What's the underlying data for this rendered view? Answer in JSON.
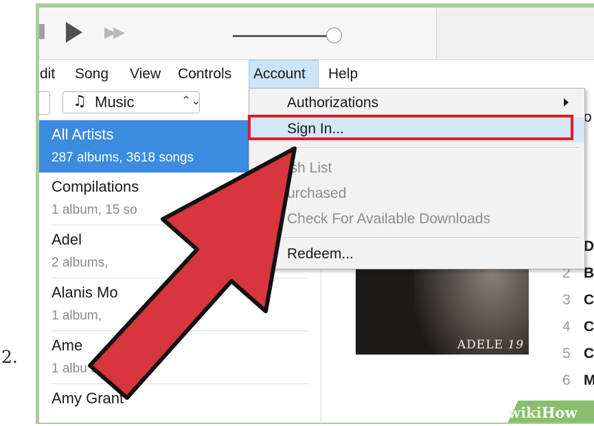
{
  "step_number": "2.",
  "menubar": {
    "items": [
      {
        "label": "dit"
      },
      {
        "label": "Song"
      },
      {
        "label": "View"
      },
      {
        "label": "Controls"
      },
      {
        "label": "Account"
      },
      {
        "label": "Help"
      }
    ],
    "active": "Account"
  },
  "source_select": {
    "icon": "music-note-icon",
    "label": "Music",
    "icon_glyph": "♫",
    "arrows_glyph": "⌃⌄"
  },
  "artists": [
    {
      "name": "All Artists",
      "detail": "287 albums, 3618 songs",
      "selected": true
    },
    {
      "name": "Compilations",
      "detail": "1 album, 15 so",
      "selected": false
    },
    {
      "name": "Adel",
      "detail": "2 albums,",
      "selected": false
    },
    {
      "name": "Alanis Mo",
      "detail": "1 album,",
      "selected": false
    },
    {
      "name": "Ame",
      "detail": "1 albu    songs",
      "selected": false
    },
    {
      "name": "Amy Grant",
      "detail": "",
      "selected": false
    }
  ],
  "account_menu": {
    "items": [
      {
        "label": "Authorizations",
        "enabled": true,
        "has_submenu": true
      },
      {
        "label": "Sign In...",
        "enabled": true,
        "highlighted": true
      },
      {
        "label": "ish List",
        "enabled": false
      },
      {
        "label": "urchased",
        "enabled": false
      },
      {
        "label": "Check For Available Downloads",
        "enabled": false
      },
      {
        "label": "Redeem...",
        "enabled": true
      }
    ]
  },
  "album": {
    "cover_text": "ADELE",
    "cover_number": "19"
  },
  "tracks": [
    {
      "num": "",
      "letter": "D"
    },
    {
      "num": "2",
      "letter": "B"
    },
    {
      "num": "3",
      "letter": "C"
    },
    {
      "num": "4",
      "letter": "C"
    },
    {
      "num": "5",
      "letter": "C"
    },
    {
      "num": "6",
      "letter": "M"
    }
  ],
  "right_header_fragment": "o",
  "watermark": {
    "part1": "wiki",
    "part2": "How"
  },
  "colors": {
    "selection_blue": "#3b8be0",
    "menu_highlight": "#d2e7f8",
    "callout_red": "#e31b23",
    "arrow_fill": "#d8353d",
    "frame_green": "#a9cd9a"
  }
}
